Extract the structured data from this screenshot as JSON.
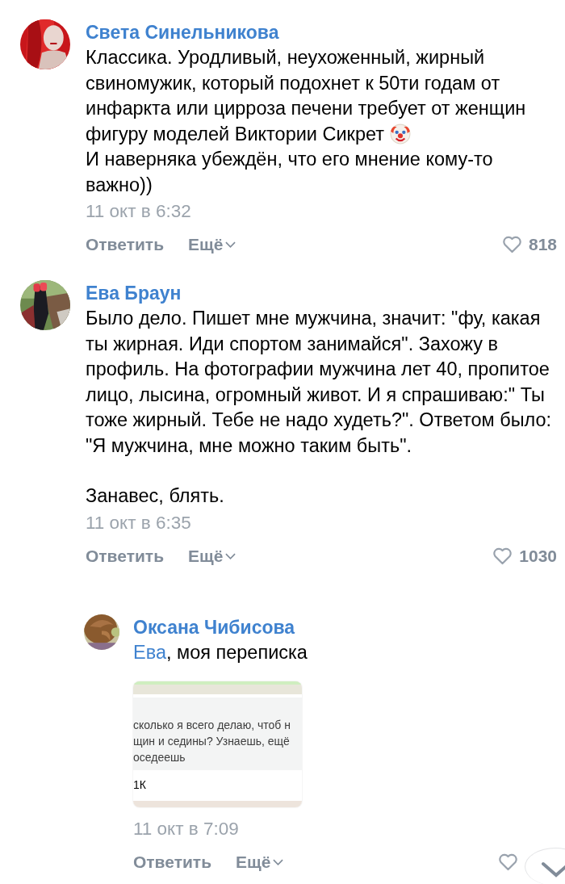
{
  "comments": [
    {
      "author": "Света Синельникова",
      "avatar": {
        "kind": "picture"
      },
      "paragraphs": [
        {
          "lines": [
            {
              "text": "Классика. Уродливый, неухоженный, жирный свиномужик, который подохнет к 50ти годам от инфаркта или цирроза печени требует от женщин фигуру моделей Виктории Сикрет",
              "emoji": true
            },
            {
              "text": "И наверняка убеждён, что его мнение кому-то важно))"
            }
          ]
        }
      ],
      "date": "11 окт в 6:32",
      "reply": "Ответить",
      "more": "Ещё",
      "likes": "818"
    },
    {
      "author": "Ева Браун",
      "avatar": {
        "kind": "picture"
      },
      "paragraphs": [
        {
          "lines": [
            {
              "text": "Было дело. Пишет мне мужчина, значит: \"фу, какая ты жирная. Иди спортом занимайся\". Захожу в профиль. На фотографии мужчина лет 40, пропитое лицо, лысина, огромный живот. И я спрашиваю:\" Ты тоже жирный. Тебе не надо худеть?\". Ответом было: \"Я мужчина, мне можно таким быть\"."
            }
          ]
        },
        {
          "lines": [
            {
              "text": "Занавес, блять."
            }
          ]
        }
      ],
      "date": "11 окт в 6:35",
      "reply": "Ответить",
      "more": "Ещё",
      "likes": "1030",
      "replies": [
        {
          "author": "Оксана Чибисова",
          "avatar": {
            "kind": "picture"
          },
          "mention": "Ева",
          "text": ", моя переписка",
          "attachment": {
            "kind": "chat_screenshot",
            "lines": [
              "сколько я всего делаю, чтоб н",
              "щин и седины? Узнаешь, ещё",
              "оседеешь"
            ],
            "footer": "1К"
          },
          "date": "11 окт в 7:09",
          "reply": "Ответить",
          "more": "Ещё"
        }
      ]
    }
  ]
}
